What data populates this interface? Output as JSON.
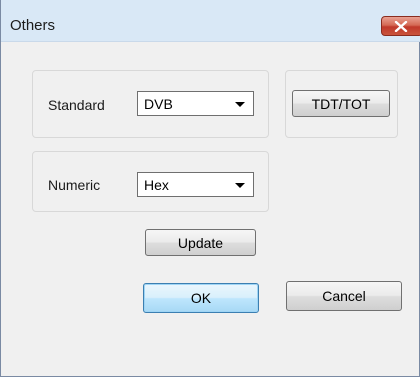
{
  "window": {
    "title": "Others"
  },
  "standard": {
    "label": "Standard",
    "value": "DVB"
  },
  "numeric": {
    "label": "Numeric",
    "value": "Hex"
  },
  "buttons": {
    "tdt_tot": "TDT/TOT",
    "update": "Update",
    "ok": "OK",
    "cancel": "Cancel"
  }
}
